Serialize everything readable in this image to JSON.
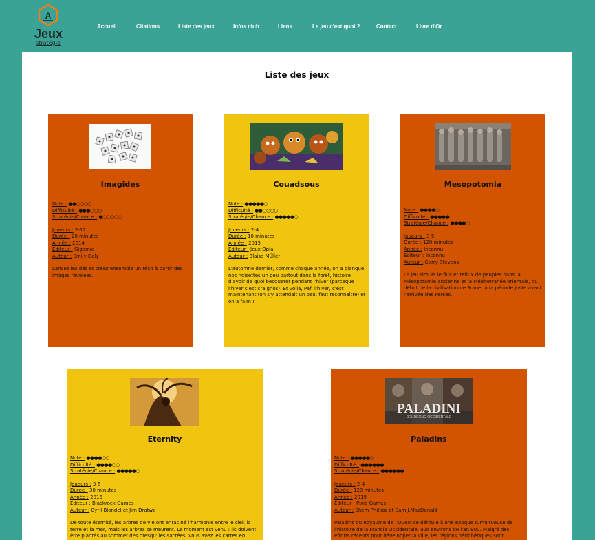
{
  "site": {
    "logo_title": "Jeux",
    "logo_subtitle": "stratégie",
    "brand_color": "#e67e22",
    "page_bg": "#3aa396"
  },
  "nav": {
    "items": [
      "Accueil",
      "Citations",
      "Liste des jeux",
      "Infos club",
      "Liens",
      "Le jeu c'est quoi ?",
      "Contact",
      "Livre d'Or"
    ]
  },
  "page": {
    "title": "Liste des jeux"
  },
  "labels": {
    "note": "Note :",
    "difficulte": "Difficulté :",
    "strategie": "Stratégie/Chance :",
    "joueurs": "Joueurs :",
    "duree": "Durée :",
    "annee": "Année :",
    "editeur": "Editeur :",
    "auteur": "Auteur :"
  },
  "colors": {
    "orange": "#d35400",
    "yellow": "#f1c40f"
  },
  "games": [
    {
      "name": "Imagides",
      "note": "●●○○○○",
      "difficulte": "●●●○○○",
      "strategie": "●○○○○○",
      "joueurs": "2-12",
      "duree": "20 minutes",
      "annee": "2014",
      "editeur": "Gigamic",
      "auteur": "Emily Daly",
      "description": "Lancez les dés et créez ensemble un récit à partir des images révélées.",
      "image": "dice-icon"
    },
    {
      "name": "Couadsous",
      "note": "●●●●●○",
      "difficulte": "●●○○○○",
      "strategie": "●●●●●○",
      "joueurs": "2-4",
      "duree": "10 minutes",
      "annee": "2015",
      "editeur": "Jeux Opla",
      "auteur": "Blaise Müller",
      "description": "L'automne dernier, comme chaque année, on a planqué nos noisettes un peu partout dans la forêt, histoire d'avoir de quoi becqueter pendant l'hiver (parceque l'hiver c'est craignos). Et voilà, Paf, l'hiver, c'est maintenant (on s'y attendait un peu, faut reconnaître) et on a faim !",
      "image": "squirrels-illustration"
    },
    {
      "name": "Mesopotomia",
      "note": "●●●●○",
      "difficulte": "●●●●●",
      "strategie": "●●●●○",
      "joueurs": "3-5",
      "duree": "120 minutes",
      "annee": "Inconnu",
      "editeur": "Inconnu",
      "auteur": "Garry Stevens",
      "description": "Le jeu simule le flux et reflux de peuples dans la Mésopotamie ancienne et la Méditerranée orientale, du début de la civilisation de Sumer à la période juste avant l'arrivée des Perses.",
      "image": "bas-relief-photo"
    },
    {
      "name": "Eternity",
      "note": "●●●●○○",
      "difficulte": "●●●●○○",
      "strategie": "●●●●●○",
      "joueurs": "3-5",
      "duree": "30 minutes",
      "annee": "2016",
      "editeur": "Blackrock Games",
      "auteur": "Cyril Blondel et Jim Dratwa",
      "description": "De toute éternité, les arbres de vie ont enraciné l'harmonie entre le ciel, la terre et la mer, mais les arbres se meurent. Le moment est venu : ils doivent être plantés au sommet des presqu'îles sacrées. Vous avez les cartes en",
      "image": "tree-woman-illustration"
    },
    {
      "name": "Paladins",
      "note": "●●●●●○",
      "difficulte": "●●●●●●",
      "strategie": "●●●●●●",
      "joueurs": "2-4",
      "duree": "120 minutes",
      "annee": "2019",
      "editeur": "Pixie Games",
      "auteur": "Shem Phillips et Sam J.MacDonald",
      "description": "Paladins du Royaume de l'Ouest se déroule à une époque tumultueuse de l'histoire de la Francie Occidentale, aux environs de l'an 900. Malgré des efforts récents pour développer la ville, les régions périphériques sont",
      "image_title": "PALADINI",
      "image_subtitle": "DEL REGNO OCCIDENTALE",
      "image": "paladins-cover"
    }
  ]
}
